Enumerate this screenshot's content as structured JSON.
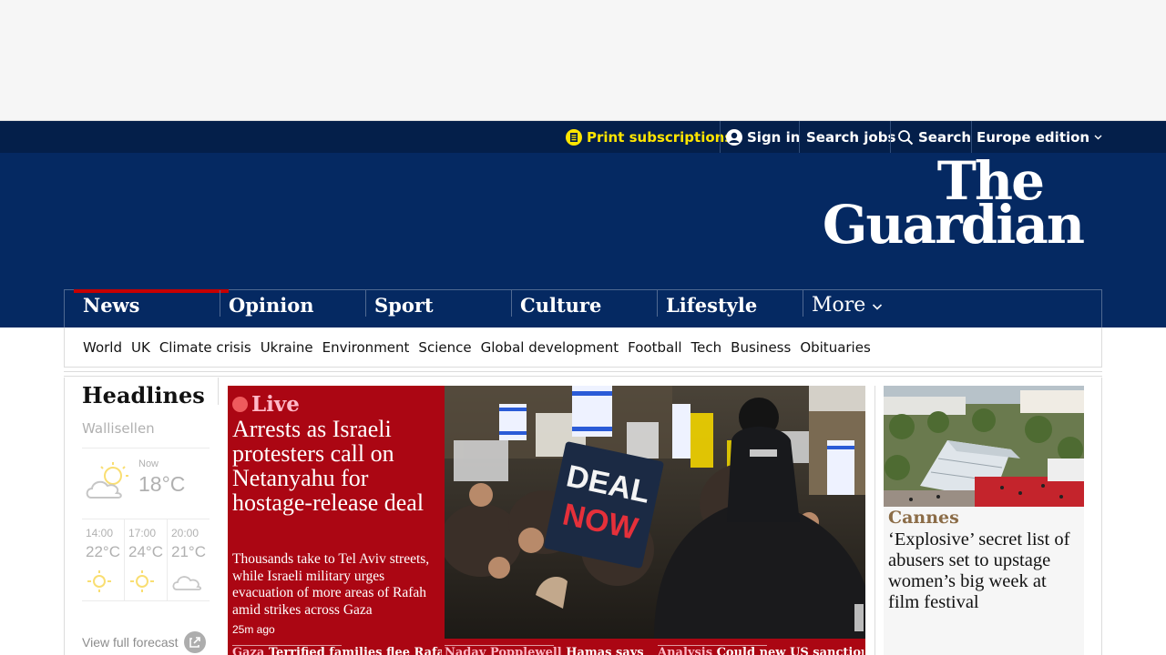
{
  "topbar": {
    "print": "Print subscriptions",
    "signin": "Sign in",
    "jobs": "Search jobs",
    "search": "Search",
    "edition": "Europe edition"
  },
  "logo": {
    "line1": "The",
    "line2": "Guardian"
  },
  "pillars": [
    "News",
    "Opinion",
    "Sport",
    "Culture",
    "Lifestyle",
    "More"
  ],
  "subnav": [
    "World",
    "UK",
    "Climate crisis",
    "Ukraine",
    "Environment",
    "Science",
    "Global development",
    "Football",
    "Tech",
    "Business",
    "Obituaries"
  ],
  "headlines": {
    "title": "Headlines",
    "weather": {
      "location": "Wallisellen",
      "now_label": "Now",
      "now_temp": "18°C",
      "hours": [
        {
          "time": "14:00",
          "temp": "22°C",
          "icon": "sun-icon"
        },
        {
          "time": "17:00",
          "temp": "24°C",
          "icon": "sun-icon"
        },
        {
          "time": "20:00",
          "temp": "21°C",
          "icon": "cloud-icon"
        }
      ],
      "forecast_link": "View full forecast"
    }
  },
  "lead": {
    "live": "Live",
    "headline": "Arrests as Israeli protesters call on Netanyahu for hostage-release deal",
    "standfirst": "Thousands take to Tel Aviv streets, while Israeli military urges evacuation of more areas of Rafah amid strikes across Gaza",
    "time": "25m ago",
    "sign_text_1": "DEAL",
    "sign_text_2": "NOW"
  },
  "sublinks": [
    {
      "kicker": "Gaza",
      "text": "Terrified families flee Rafah"
    },
    {
      "kicker": "Nadav Popplewell",
      "text": "Hamas says"
    },
    {
      "kicker": "Analysis",
      "text": "Could new US sanctions"
    }
  ],
  "side": {
    "kicker": "Cannes",
    "headline": "‘Explosive’ secret list of abusers set to upstage women’s big week at film festival"
  },
  "colors": {
    "brand_dark": "#052962",
    "topbar": "#041f4a",
    "live_red": "#ab0613",
    "print_yellow": "#ffe500",
    "news_accent": "#c70000"
  }
}
